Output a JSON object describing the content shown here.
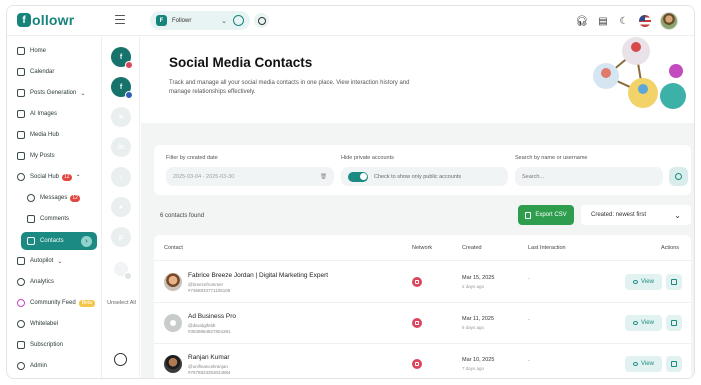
{
  "app": {
    "logo_letter": "f",
    "logo_text": "ollowr"
  },
  "workspace": {
    "avatar_letter": "F",
    "name": "Followr"
  },
  "sidebar": {
    "items": [
      {
        "label": "Home",
        "icon": "home-icon"
      },
      {
        "label": "Calendar",
        "icon": "calendar-icon"
      },
      {
        "label": "Posts Generation",
        "icon": "posts-generation-icon"
      },
      {
        "label": "AI Images",
        "icon": "ai-images-icon"
      },
      {
        "label": "Media Hub",
        "icon": "media-hub-icon"
      },
      {
        "label": "My Posts",
        "icon": "my-posts-icon"
      },
      {
        "label": "Social Hub",
        "icon": "social-hub-icon",
        "badge": "12"
      },
      {
        "label": "Messages",
        "icon": "messages-icon",
        "badge": "12"
      },
      {
        "label": "Comments",
        "icon": "comments-icon"
      },
      {
        "label": "Contacts",
        "icon": "contacts-icon"
      },
      {
        "label": "Autopilot",
        "icon": "autopilot-icon"
      },
      {
        "label": "Analytics",
        "icon": "analytics-icon"
      },
      {
        "label": "Community Feed",
        "icon": "community-feed-icon",
        "beta": "Beta"
      },
      {
        "label": "Whitelabel",
        "icon": "whitelabel-icon"
      },
      {
        "label": "Subscription",
        "icon": "subscription-icon"
      },
      {
        "label": "Admin",
        "icon": "admin-icon"
      }
    ]
  },
  "accounts": {
    "unselect_label": "Unselect All"
  },
  "hero": {
    "title": "Social Media Contacts",
    "description": "Track and manage all your social media contacts in one place. View interaction history and manage relationships effectively."
  },
  "filters": {
    "date_label": "Filter by created date",
    "date_value": "2025-03-04 - 2025-03-30",
    "private_label": "Hide private accounts",
    "private_toggle_text": "Check to show only public accounts",
    "search_label": "Search by name or username",
    "search_placeholder": "Search..."
  },
  "toolbar": {
    "count": "6 contacts found",
    "export_label": "Export CSV",
    "sort_label": "Created: newest first"
  },
  "table": {
    "headers": {
      "contact": "Contact",
      "network": "Network",
      "created": "Created",
      "last_interaction": "Last Interaction",
      "actions": "Actions"
    },
    "view_label": "View",
    "rows": [
      {
        "name": "Fabrice Breeze Jordan | Digital Marketing Expert",
        "handle": "@breezefrommer",
        "id": "#7368833771105109",
        "date": "Mar 15, 2025",
        "ago": "2 days ago",
        "interaction": "-"
      },
      {
        "name": "Ad Business Pro",
        "handle": "@davidgifeldt",
        "id": "#3539884827804391",
        "date": "Mar 11, 2025",
        "ago": "6 days ago",
        "interaction": "-"
      },
      {
        "name": "Ranjan Kumar",
        "handle": "@unifinancekranjan",
        "id": "#7678823353044884",
        "date": "Mar 10, 2025",
        "ago": "7 days ago",
        "interaction": "-"
      }
    ]
  },
  "colors": {
    "brand": "#17847c",
    "export": "#2e9e4e",
    "instagram": "#d9475e",
    "badge": "#e0473e"
  }
}
